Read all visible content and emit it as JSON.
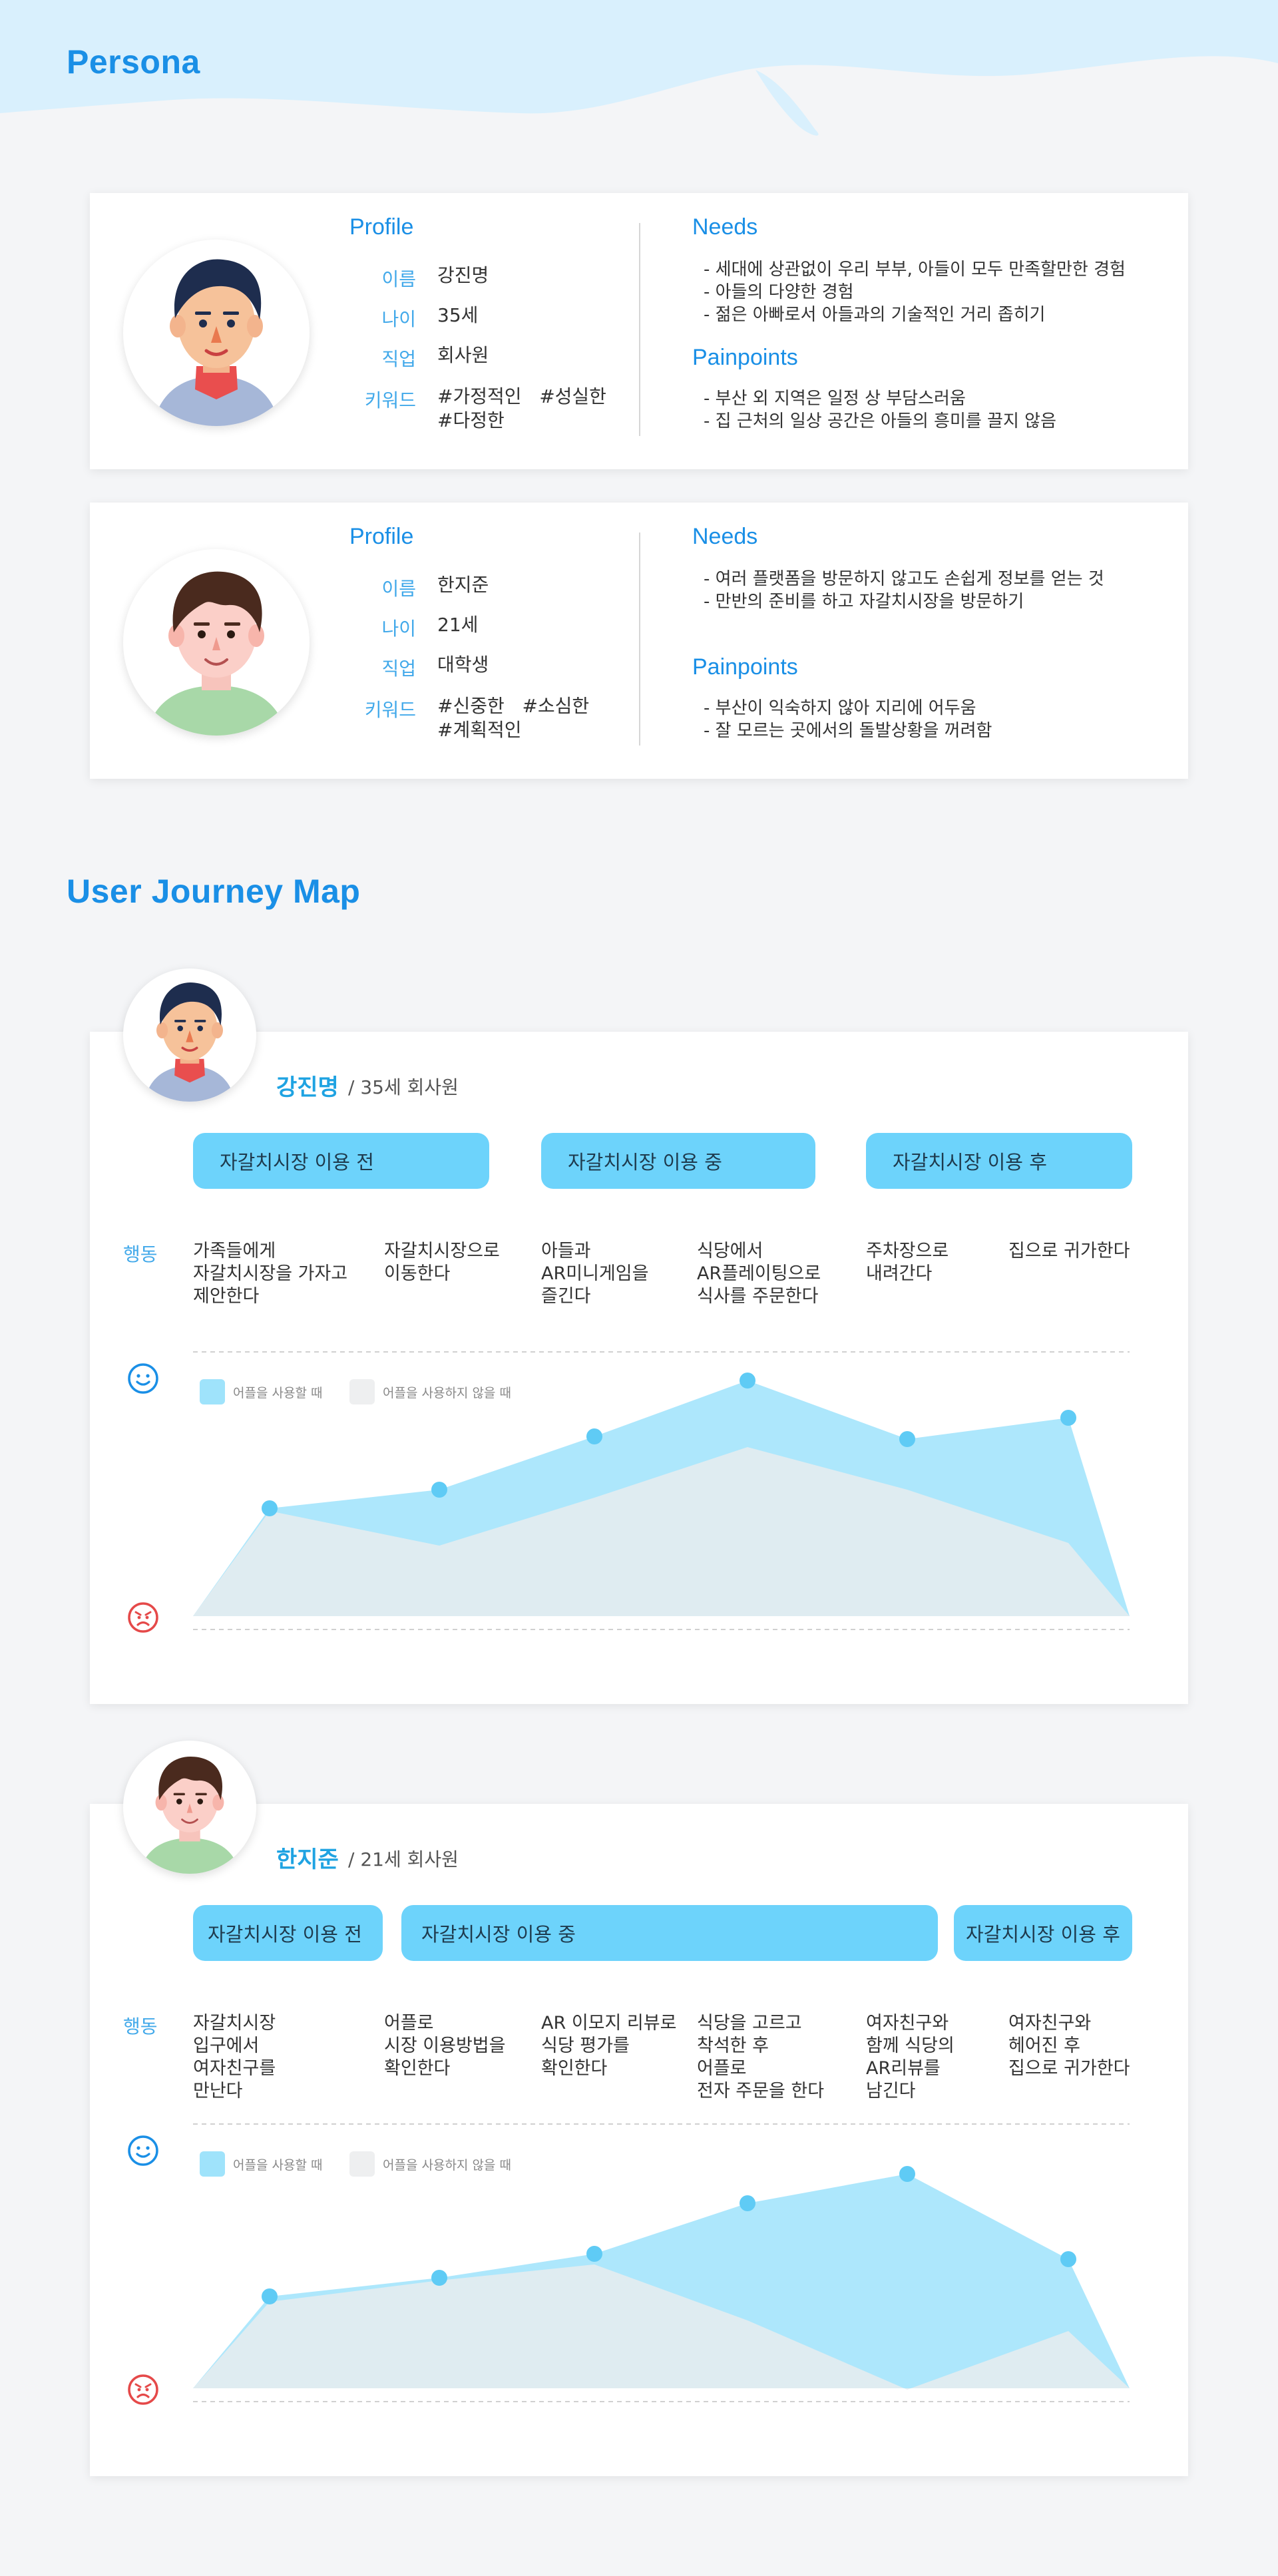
{
  "persona_section": {
    "title": "Persona"
  },
  "personas": [
    {
      "profile_title": "Profile",
      "fields": [
        {
          "label": "이름",
          "value": "강진명"
        },
        {
          "label": "나이",
          "value": "35세"
        },
        {
          "label": "직업",
          "value": "회사원"
        },
        {
          "label": "키워드",
          "value": "#가정적인   #성실한\n#다정한"
        }
      ],
      "needs_title": "Needs",
      "needs": [
        "세대에 상관없이 우리 부부, 아들이 모두 만족할만한 경험",
        "아들의 다양한 경험",
        "젊은 아빠로서 아들과의 기술적인 거리 좁히기"
      ],
      "pain_title": "Painpoints",
      "pains": [
        "부산 외 지역은 일정 상 부담스러움",
        "집 근처의 일상 공간은 아들의 흥미를 끌지 않음"
      ]
    },
    {
      "profile_title": "Profile",
      "fields": [
        {
          "label": "이름",
          "value": "한지준"
        },
        {
          "label": "나이",
          "value": "21세"
        },
        {
          "label": "직업",
          "value": "대학생"
        },
        {
          "label": "키워드",
          "value": "#신중한   #소심한\n#계획적인"
        }
      ],
      "needs_title": "Needs",
      "needs": [
        "여러 플랫폼을 방문하지 않고도 손쉽게 정보를 얻는 것",
        "만반의 준비를 하고 자갈치시장을 방문하기"
      ],
      "pain_title": "Painpoints",
      "pains": [
        "부산이 익숙하지 않아 지리에 어두움",
        "잘 모르는 곳에서의 돌발상황을 꺼려함"
      ]
    }
  ],
  "journey_section": {
    "title": "User Journey Map"
  },
  "journeys": [
    {
      "name": "강진명",
      "desc": "/ 35세 회사원",
      "phases": [
        "자갈치시장 이용 전",
        "자갈치시장 이용 중",
        "자갈치시장 이용 후"
      ],
      "action_label": "행동",
      "actions": [
        "가족들에게\n자갈치시장을 가자고\n제안한다",
        "자갈치시장으로\n이동한다",
        "아들과\nAR미니게임을\n즐긴다",
        "식당에서\nAR플레이팅으로\n식사를 주문한다",
        "주차장으로\n내려간다",
        "집으로 귀가한다"
      ],
      "legend": [
        "어플을 사용할 때",
        "어플을 사용하지 않을 때"
      ]
    },
    {
      "name": "한지준",
      "desc": "/ 21세 회사원",
      "phases": [
        "자갈치시장 이용 전",
        "자갈치시장 이용 중",
        "자갈치시장 이용 후"
      ],
      "action_label": "행동",
      "actions": [
        "자갈치시장\n입구에서\n여자친구를\n만난다",
        "어플로\n시장 이용방법을\n확인한다",
        "AR 이모지 리뷰로\n식당 평가를\n확인한다",
        "식당을 고르고\n착석한 후\n어플로\n전자 주문을 한다",
        "여자친구와\n함께 식당의\nAR리뷰를\n남긴다",
        "여자친구와\n헤어진 후\n집으로 귀가한다"
      ],
      "legend": [
        "어플을 사용할 때",
        "어플을 사용하지 않을 때"
      ]
    }
  ],
  "chart_data": [
    {
      "type": "area",
      "x": [
        1,
        2,
        3,
        4,
        5,
        6
      ],
      "ylim": [
        0,
        100
      ],
      "series": [
        {
          "name": "어플을 사용할 때",
          "values": [
            46,
            53,
            73,
            94,
            72,
            80
          ]
        },
        {
          "name": "어플을 사용하지 않을 때",
          "values": [
            45,
            32,
            50,
            69,
            53,
            33
          ]
        }
      ]
    },
    {
      "type": "area",
      "x": [
        1,
        2,
        3,
        4,
        5,
        6
      ],
      "ylim": [
        0,
        100
      ],
      "series": [
        {
          "name": "어플을 사용할 때",
          "values": [
            40,
            47,
            56,
            75,
            86,
            54
          ]
        },
        {
          "name": "어플을 사용하지 않을 때",
          "values": [
            38,
            46,
            52,
            31,
            5,
            27
          ]
        }
      ]
    }
  ],
  "colors": {
    "accent": "#1a8fe6",
    "wave": "#d9f0fd",
    "phase": "#6dd3fb",
    "with_app": "#9fe3fb",
    "without_app": "#e4ecf0",
    "point": "#5fcbf5",
    "happy_icon": "#1a8fe6",
    "sad_icon": "#e54949"
  },
  "icons": {
    "happy": "happy-face-icon",
    "sad": "angry-face-icon"
  }
}
